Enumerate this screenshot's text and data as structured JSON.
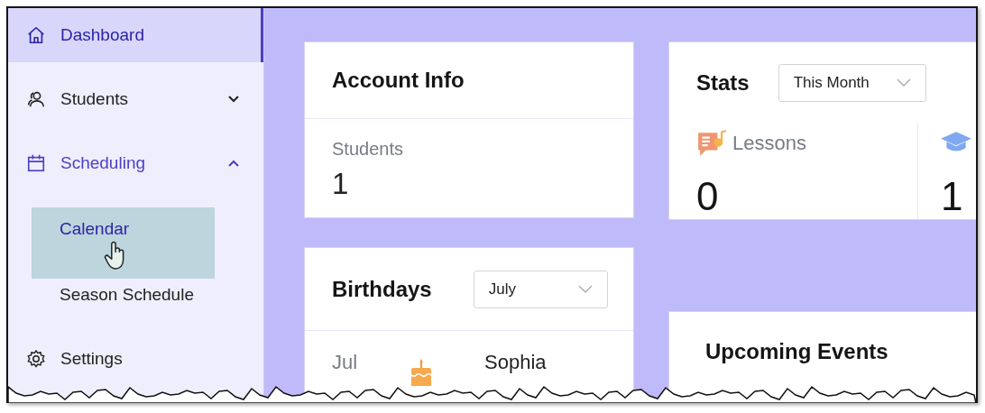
{
  "sidebar": {
    "items": [
      {
        "label": "Dashboard",
        "selected": true
      },
      {
        "label": "Students",
        "selected": false,
        "expanded": false
      },
      {
        "label": "Scheduling",
        "selected": false,
        "expanded": true,
        "children": [
          {
            "label": "Calendar",
            "hovered": true
          },
          {
            "label": "Season Schedule",
            "hovered": false
          }
        ]
      },
      {
        "label": "Settings",
        "selected": false
      }
    ]
  },
  "account_info": {
    "title": "Account Info",
    "stats": [
      {
        "label": "Students",
        "value": "1"
      }
    ]
  },
  "birthdays": {
    "title": "Birthdays",
    "month_select": {
      "value": "July"
    },
    "rows": [
      {
        "month": "Jul",
        "name": "Sophia"
      }
    ]
  },
  "stats": {
    "title": "Stats",
    "period_select": {
      "value": "This Month"
    },
    "items": [
      {
        "label": "Lessons",
        "value": "0"
      },
      {
        "value": "1"
      }
    ]
  },
  "upcoming_events": {
    "title": "Upcoming Events"
  }
}
